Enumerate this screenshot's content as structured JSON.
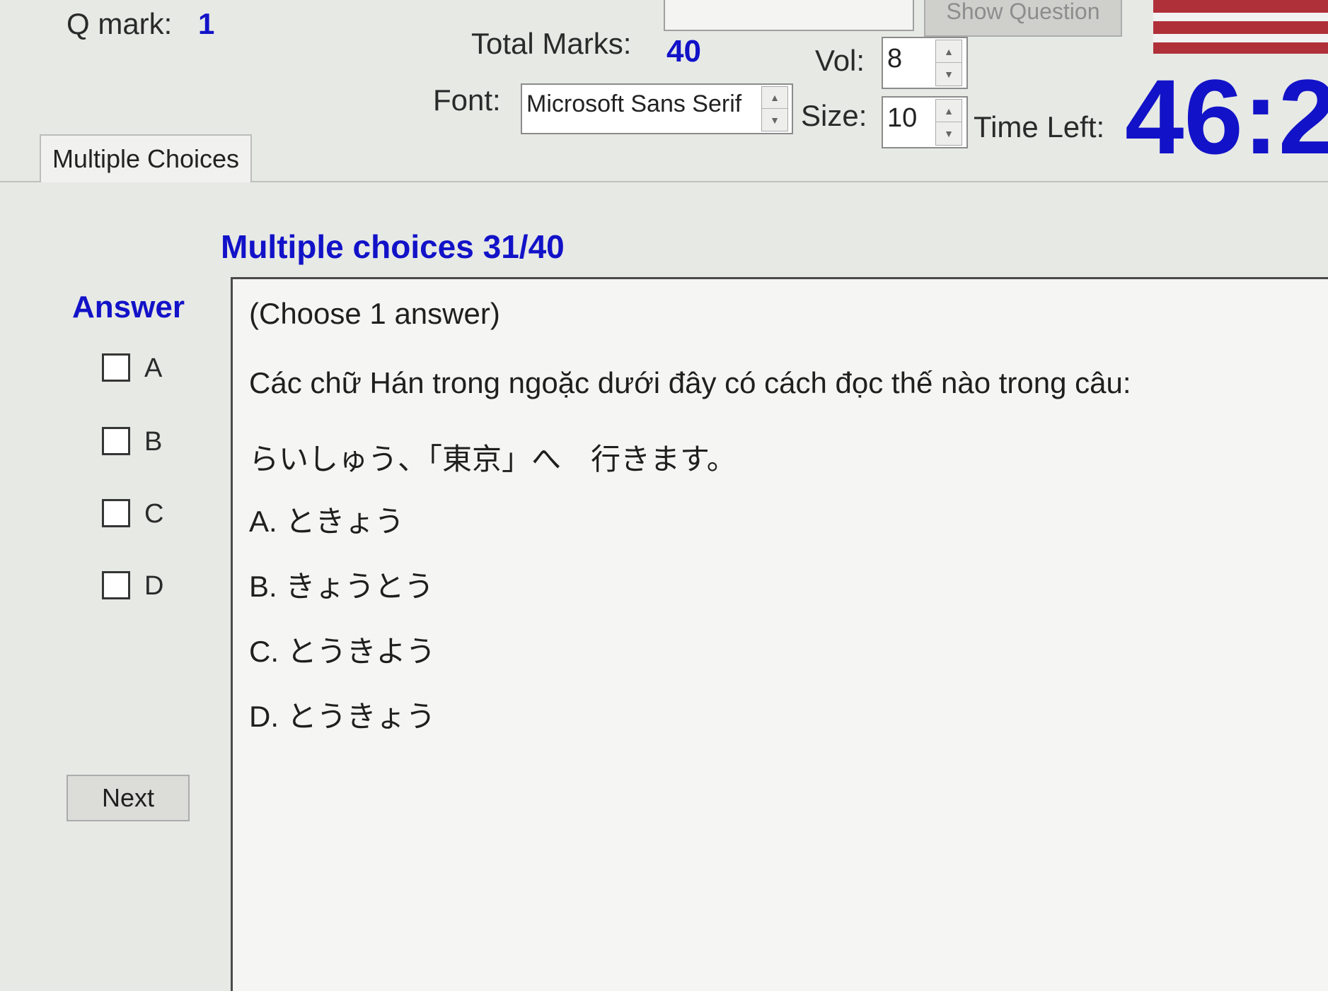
{
  "header": {
    "q_mark_label": "Q mark:",
    "q_mark_value": "1",
    "total_marks_label": "Total Marks:",
    "total_marks_value": "40",
    "show_question_label": "Show Question",
    "vol_label": "Vol:",
    "vol_value": "8",
    "font_label": "Font:",
    "font_value": "Microsoft Sans Serif",
    "size_label": "Size:",
    "size_value": "10",
    "time_left_label": "Time Left:",
    "time_left_value": "46:2"
  },
  "tabs": [
    {
      "label": "Multiple Choices"
    }
  ],
  "section_title": "Multiple choices 31/40",
  "answer_panel": {
    "title": "Answer",
    "options": [
      {
        "label": "A"
      },
      {
        "label": "B"
      },
      {
        "label": "C"
      },
      {
        "label": "D"
      }
    ],
    "next_label": "Next"
  },
  "question": {
    "instruction": "(Choose 1 answer)",
    "prompt": "Các chữ Hán trong ngoặc dưới đây có cách đọc thế nào trong câu:",
    "sentence": "らいしゅう、「東京」へ　行きます。",
    "choices": [
      "A. ときょう",
      "B. きょうとう",
      "C. とうきよう",
      "D. とうきょう"
    ]
  },
  "colors": {
    "accent_blue": "#1212c8",
    "background": "#e7e9e5",
    "flag_red": "#b0303a"
  }
}
